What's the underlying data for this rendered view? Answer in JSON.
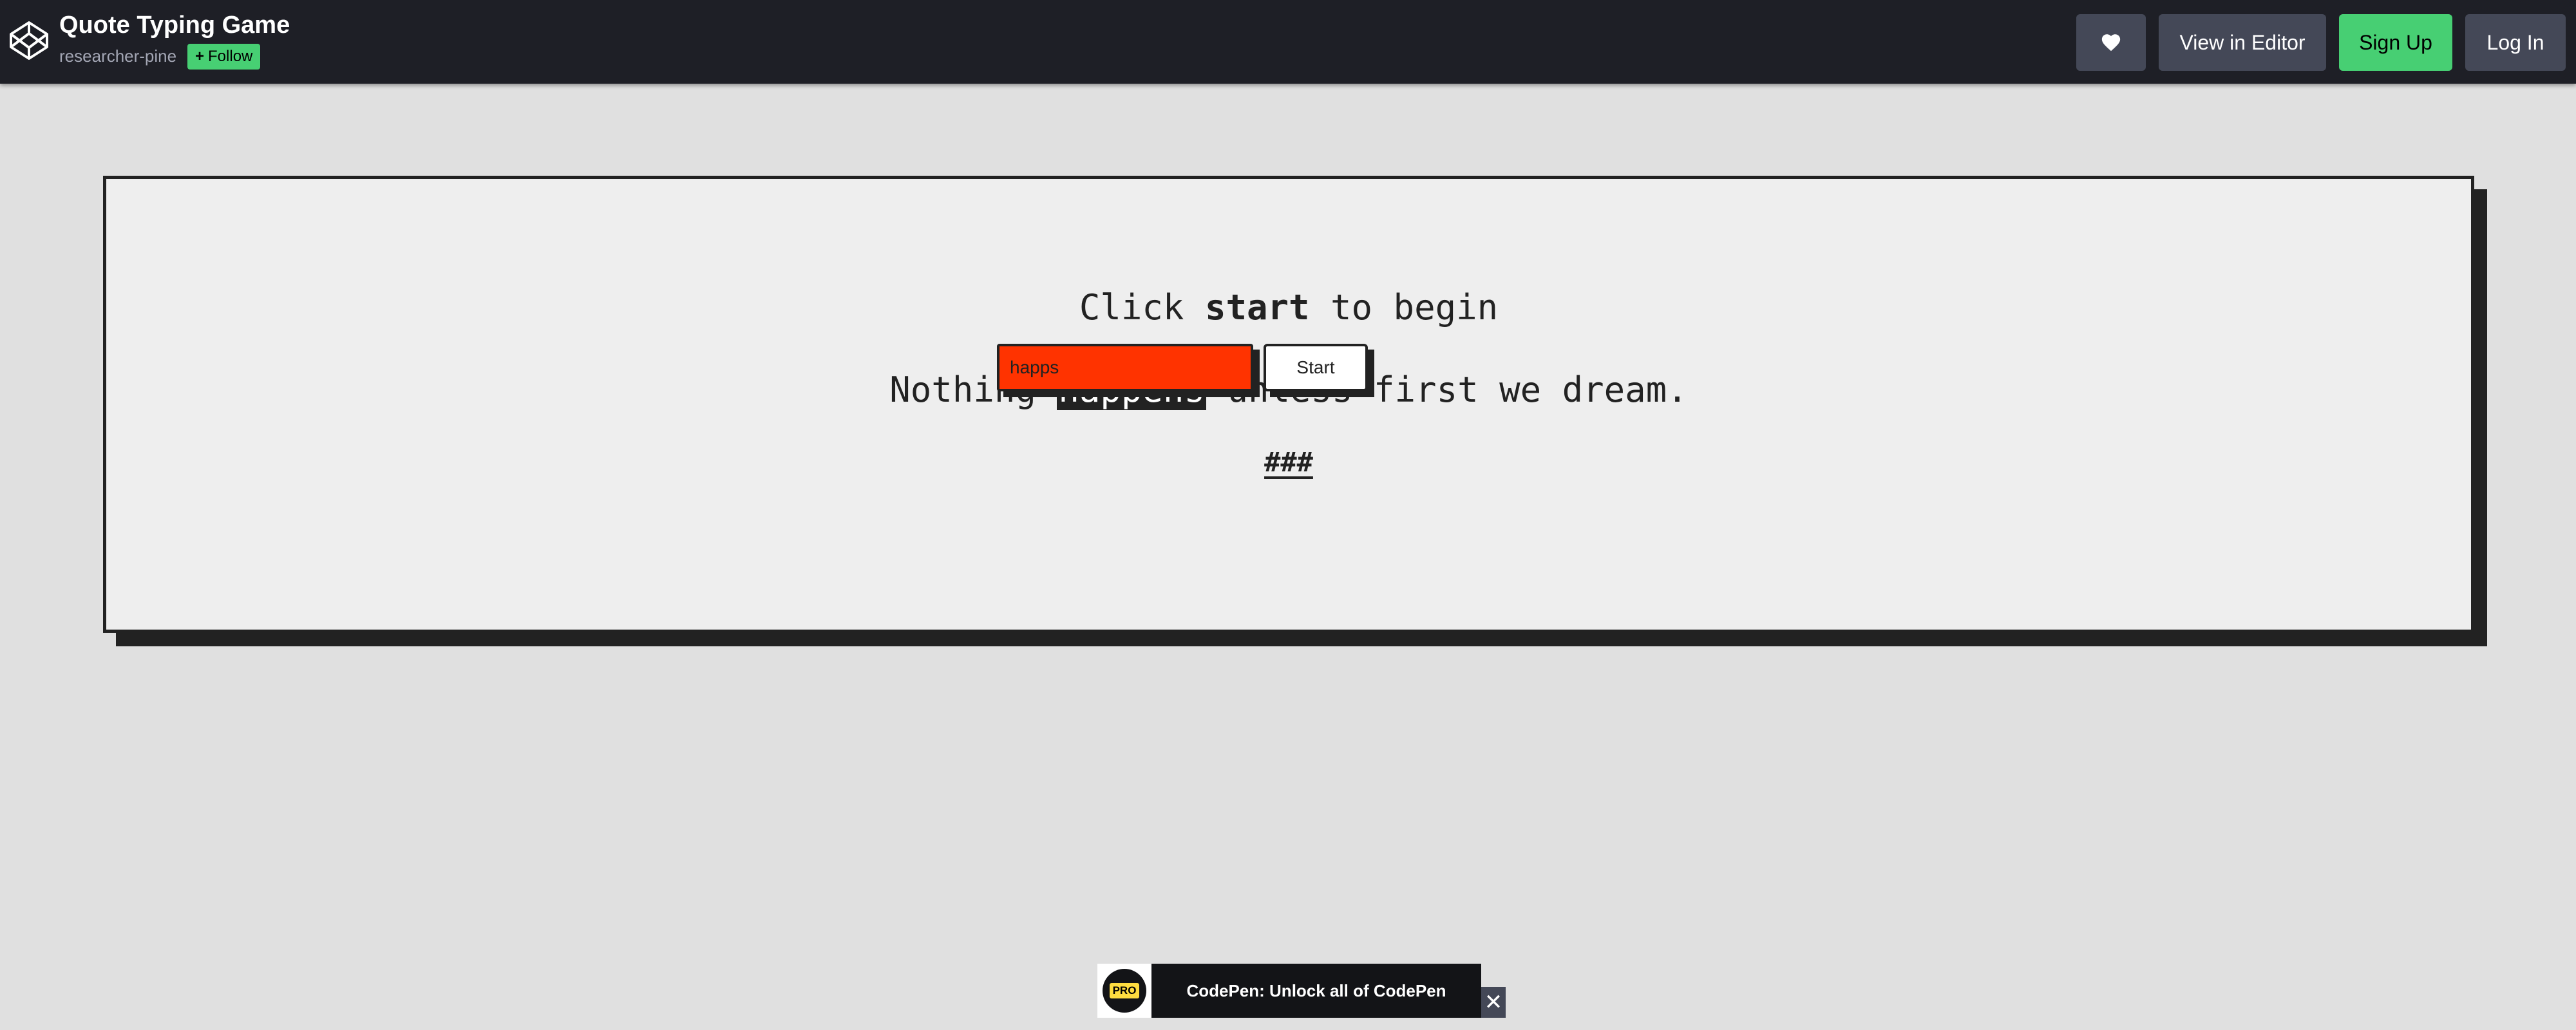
{
  "header": {
    "title": "Quote Typing Game",
    "author": "researcher-pine",
    "follow_label": "Follow",
    "heart_icon": "heart-icon",
    "view_in_editor_label": "View in Editor",
    "sign_up_label": "Sign Up",
    "log_in_label": "Log In",
    "accent_color": "#47cf73"
  },
  "game": {
    "instruction_prefix": "Click ",
    "instruction_emphasis": "start",
    "instruction_suffix": " to begin",
    "quote_before": "Nothing ",
    "quote_highlight": "happens",
    "quote_after": " unless first we dream.",
    "score": "###",
    "input_value": "happs",
    "input_color": "#ff3300",
    "start_label": "Start"
  },
  "banner": {
    "badge": "PRO",
    "text": "CodePen: Unlock all of CodePen",
    "close_icon": "close-icon"
  }
}
